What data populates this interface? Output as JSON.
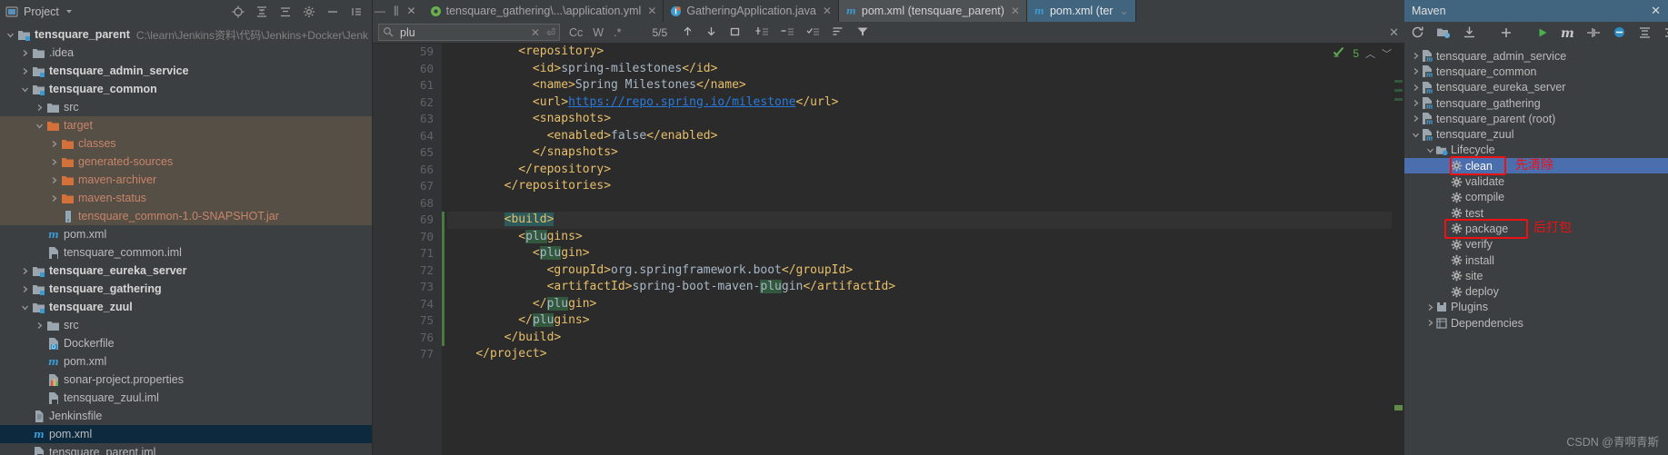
{
  "project": {
    "title": "Project",
    "icons": [
      "project-view-icon",
      "locate-icon",
      "collapse-all-icon",
      "expand-all-icon",
      "settings-gear-icon",
      "hide-icon"
    ],
    "tree": [
      {
        "label": "tensquare_parent",
        "path": "C:\\learn\\Jenkins资料\\代码\\Jenkins+Docker\\Jenk",
        "depth": 0,
        "arrow": "down",
        "icon": "module-icon",
        "bold": true,
        "state": "normal"
      },
      {
        "label": ".idea",
        "depth": 1,
        "arrow": "right",
        "icon": "folder-icon",
        "bold": false,
        "state": "normal"
      },
      {
        "label": "tensquare_admin_service",
        "depth": 1,
        "arrow": "right",
        "icon": "module-icon",
        "bold": true,
        "state": "normal"
      },
      {
        "label": "tensquare_common",
        "depth": 1,
        "arrow": "down",
        "icon": "module-icon",
        "bold": true,
        "state": "normal"
      },
      {
        "label": "src",
        "depth": 2,
        "arrow": "right",
        "icon": "folder-icon",
        "bold": false,
        "state": "normal"
      },
      {
        "label": "target",
        "depth": 2,
        "arrow": "down",
        "icon": "folder-orange-icon",
        "bold": false,
        "state": "excluded"
      },
      {
        "label": "classes",
        "depth": 3,
        "arrow": "right",
        "icon": "folder-orange-icon",
        "bold": false,
        "state": "excluded"
      },
      {
        "label": "generated-sources",
        "depth": 3,
        "arrow": "right",
        "icon": "folder-orange-icon",
        "bold": false,
        "state": "excluded"
      },
      {
        "label": "maven-archiver",
        "depth": 3,
        "arrow": "right",
        "icon": "folder-orange-icon",
        "bold": false,
        "state": "excluded"
      },
      {
        "label": "maven-status",
        "depth": 3,
        "arrow": "right",
        "icon": "folder-orange-icon",
        "bold": false,
        "state": "excluded"
      },
      {
        "label": "tensquare_common-1.0-SNAPSHOT.jar",
        "depth": 3,
        "arrow": "none",
        "icon": "jar-icon",
        "bold": false,
        "state": "excluded"
      },
      {
        "label": "pom.xml",
        "depth": 2,
        "arrow": "none",
        "icon": "maven-icon",
        "bold": false,
        "state": "normal"
      },
      {
        "label": "tensquare_common.iml",
        "depth": 2,
        "arrow": "none",
        "icon": "iml-icon",
        "bold": false,
        "state": "normal"
      },
      {
        "label": "tensquare_eureka_server",
        "depth": 1,
        "arrow": "right",
        "icon": "module-icon",
        "bold": true,
        "state": "normal"
      },
      {
        "label": "tensquare_gathering",
        "depth": 1,
        "arrow": "right",
        "icon": "module-icon",
        "bold": true,
        "state": "normal"
      },
      {
        "label": "tensquare_zuul",
        "depth": 1,
        "arrow": "down",
        "icon": "module-icon",
        "bold": true,
        "state": "normal"
      },
      {
        "label": "src",
        "depth": 2,
        "arrow": "right",
        "icon": "folder-icon",
        "bold": false,
        "state": "normal"
      },
      {
        "label": "Dockerfile",
        "depth": 2,
        "arrow": "none",
        "icon": "docker-icon",
        "bold": false,
        "state": "normal"
      },
      {
        "label": "pom.xml",
        "depth": 2,
        "arrow": "none",
        "icon": "maven-icon",
        "bold": false,
        "state": "normal"
      },
      {
        "label": "sonar-project.properties",
        "depth": 2,
        "arrow": "none",
        "icon": "properties-icon",
        "bold": false,
        "state": "normal"
      },
      {
        "label": "tensquare_zuul.iml",
        "depth": 2,
        "arrow": "none",
        "icon": "iml-icon",
        "bold": false,
        "state": "normal"
      },
      {
        "label": "Jenkinsfile",
        "depth": 1,
        "arrow": "none",
        "icon": "file-icon",
        "bold": false,
        "state": "normal"
      },
      {
        "label": "pom.xml",
        "depth": 1,
        "arrow": "none",
        "icon": "maven-icon",
        "bold": false,
        "state": "selected"
      },
      {
        "label": "tensquare_parent.iml",
        "depth": 1,
        "arrow": "none",
        "icon": "iml-icon",
        "bold": false,
        "state": "normal"
      }
    ]
  },
  "editor": {
    "tabs": [
      {
        "label": "tensquare_gathering\\...\\application.yml",
        "icon": "yml-icon",
        "state": "normal",
        "closable": true
      },
      {
        "label": "GatheringApplication.java",
        "icon": "java-icon",
        "state": "normal",
        "closable": true
      },
      {
        "label": "pom.xml (tensquare_parent)",
        "icon": "maven-icon",
        "state": "active",
        "closable": true
      },
      {
        "label": "pom.xml (ter",
        "icon": "maven-icon",
        "state": "selected",
        "closable": false
      }
    ],
    "find": {
      "value": "plu",
      "placeholder": "Search",
      "match_count": "5/5",
      "toggles": [
        "Cc",
        "W",
        ".*"
      ],
      "icons": [
        "search-icon",
        "clear-icon",
        "history-icon",
        "prev-match-icon",
        "next-match-icon",
        "select-all-icon",
        "add-line-icon",
        "remove-line-icon",
        "toggle-lines-icon",
        "filter-list-icon",
        "filter-icon",
        "close-find-icon"
      ]
    },
    "inspection": {
      "count": "5",
      "status": "ok-check-icon"
    },
    "lines": [
      {
        "n": "59",
        "segments": [
          {
            "t": "          ",
            "c": "txt"
          },
          {
            "t": "<repository>",
            "c": "tg"
          }
        ],
        "fold": "collapse"
      },
      {
        "n": "60",
        "segments": [
          {
            "t": "            ",
            "c": "txt"
          },
          {
            "t": "<id>",
            "c": "tg"
          },
          {
            "t": "spring-milestones",
            "c": "txt"
          },
          {
            "t": "</id>",
            "c": "tg"
          }
        ],
        "fold": ""
      },
      {
        "n": "61",
        "segments": [
          {
            "t": "            ",
            "c": "txt"
          },
          {
            "t": "<name>",
            "c": "tg"
          },
          {
            "t": "Spring Milestones",
            "c": "txt"
          },
          {
            "t": "</name>",
            "c": "tg"
          }
        ],
        "fold": ""
      },
      {
        "n": "62",
        "segments": [
          {
            "t": "            ",
            "c": "txt"
          },
          {
            "t": "<url>",
            "c": "tg"
          },
          {
            "t": "https://repo.spring.io/milestone",
            "c": "url"
          },
          {
            "t": "</url>",
            "c": "tg"
          }
        ],
        "fold": ""
      },
      {
        "n": "63",
        "segments": [
          {
            "t": "            ",
            "c": "txt"
          },
          {
            "t": "<snapshots>",
            "c": "tg"
          }
        ],
        "fold": "collapse"
      },
      {
        "n": "64",
        "segments": [
          {
            "t": "              ",
            "c": "txt"
          },
          {
            "t": "<enabled>",
            "c": "tg"
          },
          {
            "t": "false",
            "c": "txt"
          },
          {
            "t": "</enabled>",
            "c": "tg"
          }
        ],
        "fold": ""
      },
      {
        "n": "65",
        "segments": [
          {
            "t": "            ",
            "c": "txt"
          },
          {
            "t": "</snapshots>",
            "c": "tg"
          }
        ],
        "fold": "end"
      },
      {
        "n": "66",
        "segments": [
          {
            "t": "          ",
            "c": "txt"
          },
          {
            "t": "</repository>",
            "c": "tg"
          }
        ],
        "fold": "end"
      },
      {
        "n": "67",
        "segments": [
          {
            "t": "        ",
            "c": "txt"
          },
          {
            "t": "</repositories>",
            "c": "tg"
          }
        ],
        "fold": "end"
      },
      {
        "n": "68",
        "segments": [
          {
            "t": "",
            "c": "txt"
          }
        ],
        "fold": ""
      },
      {
        "n": "69",
        "segments": [
          {
            "t": "        ",
            "c": "txt"
          },
          {
            "t": "<build>",
            "c": "buildsel"
          }
        ],
        "fold": "collapse",
        "current": true
      },
      {
        "n": "70",
        "segments": [
          {
            "t": "          ",
            "c": "txt"
          },
          {
            "t": "<",
            "c": "tg"
          },
          {
            "t": "plu",
            "c": "hl"
          },
          {
            "t": "gins>",
            "c": "tg"
          }
        ],
        "fold": "collapse"
      },
      {
        "n": "71",
        "segments": [
          {
            "t": "            ",
            "c": "txt"
          },
          {
            "t": "<",
            "c": "tg"
          },
          {
            "t": "plu",
            "c": "hl"
          },
          {
            "t": "gin>",
            "c": "tg"
          }
        ],
        "fold": "collapse"
      },
      {
        "n": "72",
        "segments": [
          {
            "t": "              ",
            "c": "txt"
          },
          {
            "t": "<groupId>",
            "c": "tg"
          },
          {
            "t": "org.springframework.boot",
            "c": "txt"
          },
          {
            "t": "</groupId>",
            "c": "tg"
          }
        ],
        "fold": ""
      },
      {
        "n": "73",
        "segments": [
          {
            "t": "              ",
            "c": "txt"
          },
          {
            "t": "<artifactId>",
            "c": "tg"
          },
          {
            "t": "spring-boot-maven-",
            "c": "txt"
          },
          {
            "t": "plu",
            "c": "hl"
          },
          {
            "t": "gin",
            "c": "txt"
          },
          {
            "t": "</artifactId>",
            "c": "tg"
          }
        ],
        "fold": "",
        "run": true
      },
      {
        "n": "74",
        "segments": [
          {
            "t": "            ",
            "c": "txt"
          },
          {
            "t": "</",
            "c": "tg"
          },
          {
            "t": "plu",
            "c": "hl"
          },
          {
            "t": "gin>",
            "c": "tg"
          }
        ],
        "fold": "end"
      },
      {
        "n": "75",
        "segments": [
          {
            "t": "          ",
            "c": "txt"
          },
          {
            "t": "</",
            "c": "tg"
          },
          {
            "t": "plu",
            "c": "hl"
          },
          {
            "t": "gins>",
            "c": "tg"
          }
        ],
        "fold": "end"
      },
      {
        "n": "76",
        "segments": [
          {
            "t": "        ",
            "c": "txt"
          },
          {
            "t": "</build>",
            "c": "tg"
          }
        ],
        "fold": "end"
      },
      {
        "n": "77",
        "segments": [
          {
            "t": "    ",
            "c": "txt"
          },
          {
            "t": "</project>",
            "c": "tg"
          }
        ],
        "fold": "end"
      }
    ]
  },
  "maven": {
    "title": "Maven",
    "toolbar_icons": [
      "reload-icon",
      "generate-sources-icon",
      "download-sources-icon",
      "add-icon",
      "run-icon",
      "execute-goal-icon",
      "toggle-offline-icon",
      "skip-tests-icon",
      "settings-icon",
      "collapse-icon",
      "expand-icon",
      "help-icon"
    ],
    "tree": [
      {
        "label": "tensquare_admin_service",
        "depth": 0,
        "arrow": "right",
        "icon": "maven-project-icon",
        "state": "normal"
      },
      {
        "label": "tensquare_common",
        "depth": 0,
        "arrow": "right",
        "icon": "maven-project-icon",
        "state": "normal"
      },
      {
        "label": "tensquare_eureka_server",
        "depth": 0,
        "arrow": "right",
        "icon": "maven-project-icon",
        "state": "normal"
      },
      {
        "label": "tensquare_gathering",
        "depth": 0,
        "arrow": "right",
        "icon": "maven-project-icon",
        "state": "normal"
      },
      {
        "label": "tensquare_parent (root)",
        "depth": 0,
        "arrow": "right",
        "icon": "maven-project-icon",
        "state": "normal"
      },
      {
        "label": "tensquare_zuul",
        "depth": 0,
        "arrow": "down",
        "icon": "maven-project-icon",
        "state": "normal"
      },
      {
        "label": "Lifecycle",
        "depth": 1,
        "arrow": "down",
        "icon": "lifecycle-folder-icon",
        "state": "normal"
      },
      {
        "label": "clean",
        "depth": 2,
        "arrow": "none",
        "icon": "goal-gear-icon",
        "state": "selected"
      },
      {
        "label": "validate",
        "depth": 2,
        "arrow": "none",
        "icon": "goal-gear-icon",
        "state": "normal"
      },
      {
        "label": "compile",
        "depth": 2,
        "arrow": "none",
        "icon": "goal-gear-icon",
        "state": "normal"
      },
      {
        "label": "test",
        "depth": 2,
        "arrow": "none",
        "icon": "goal-gear-icon",
        "state": "normal"
      },
      {
        "label": "package",
        "depth": 2,
        "arrow": "none",
        "icon": "goal-gear-icon",
        "state": "normal"
      },
      {
        "label": "verify",
        "depth": 2,
        "arrow": "none",
        "icon": "goal-gear-icon",
        "state": "normal"
      },
      {
        "label": "install",
        "depth": 2,
        "arrow": "none",
        "icon": "goal-gear-icon",
        "state": "normal"
      },
      {
        "label": "site",
        "depth": 2,
        "arrow": "none",
        "icon": "goal-gear-icon",
        "state": "normal"
      },
      {
        "label": "deploy",
        "depth": 2,
        "arrow": "none",
        "icon": "goal-gear-icon",
        "state": "normal"
      },
      {
        "label": "Plugins",
        "depth": 1,
        "arrow": "right",
        "icon": "plugins-folder-icon",
        "state": "normal"
      },
      {
        "label": "Dependencies",
        "depth": 1,
        "arrow": "right",
        "icon": "dependencies-icon",
        "state": "normal"
      }
    ]
  },
  "annotations": {
    "color": "#ee1111",
    "clean_note": "先清除",
    "package_note": "后打包"
  },
  "watermark": "CSDN @青啊青斯"
}
